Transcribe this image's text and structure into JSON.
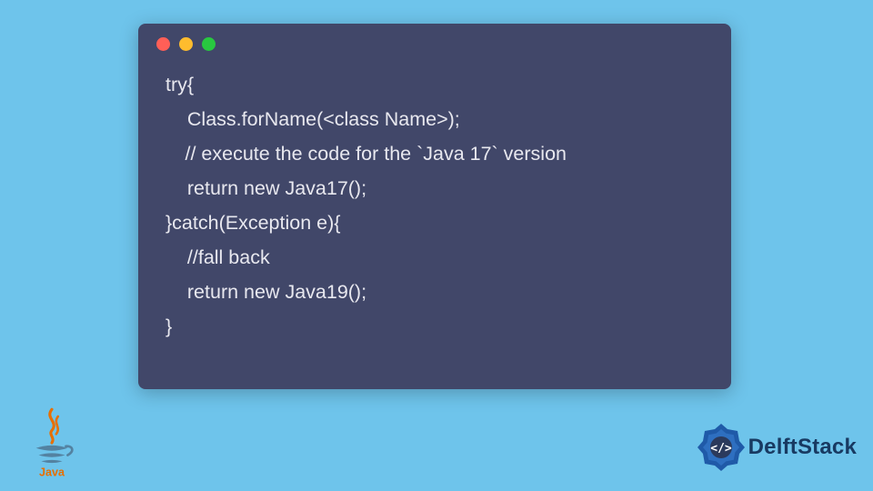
{
  "window": {
    "dots": {
      "red": "#ff5f57",
      "yellow": "#febc2e",
      "green": "#28c840"
    },
    "bg": "#414769"
  },
  "code": {
    "lines": [
      "try{",
      "    Class.forName(<class Name>);",
      " // execute the code for the `Java 17` version",
      "    return new Java17();",
      "}catch(Exception e){",
      "    //fall back",
      "    return new Java19();",
      "}"
    ]
  },
  "logos": {
    "java_label": "Java",
    "delft_label": "DelftStack"
  },
  "page_bg": "#6ec4eb"
}
